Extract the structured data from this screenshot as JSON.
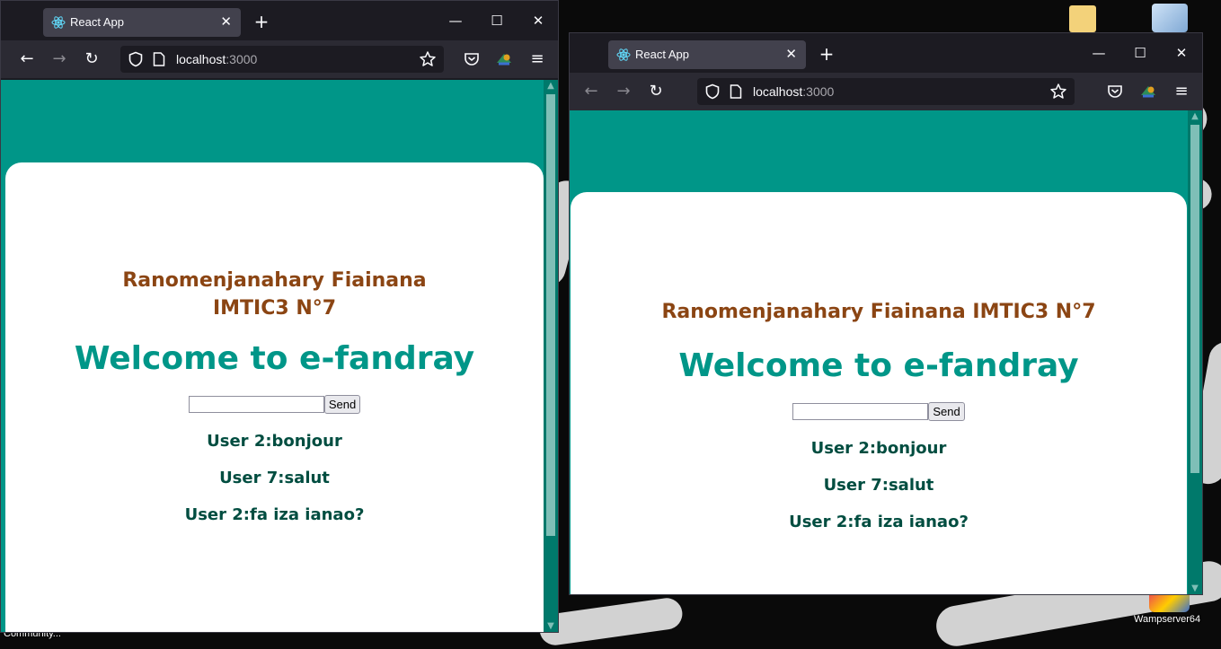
{
  "desktop": {
    "wamp_label": "Wampserver64",
    "community_label": "Community..."
  },
  "left_window": {
    "tab_title": "React App",
    "new_tab": "+",
    "url_host": "localhost",
    "url_port": ":3000",
    "app": {
      "author": "Ranomenjanahary Fiainana IMTIC3 N°7",
      "welcome": "Welcome to e-fandray",
      "input_placeholder": "",
      "send_label": "Send",
      "messages": [
        "User 2:bonjour",
        "User 7:salut",
        "User 2:fa iza ianao?"
      ]
    }
  },
  "right_window": {
    "tab_title": "React App",
    "new_tab": "+",
    "url_host": "localhost",
    "url_port": ":3000",
    "app": {
      "author": "Ranomenjanahary Fiainana IMTIC3 N°7",
      "welcome": "Welcome to e-fandray",
      "input_placeholder": "",
      "send_label": "Send",
      "messages": [
        "User 2:bonjour",
        "User 7:salut",
        "User 2:fa iza ianao?"
      ]
    }
  },
  "colors": {
    "header_teal": "#009688",
    "author_brown": "#8b4513",
    "message_dark_teal": "#004d40",
    "browser_chrome": "#2b2a33"
  }
}
